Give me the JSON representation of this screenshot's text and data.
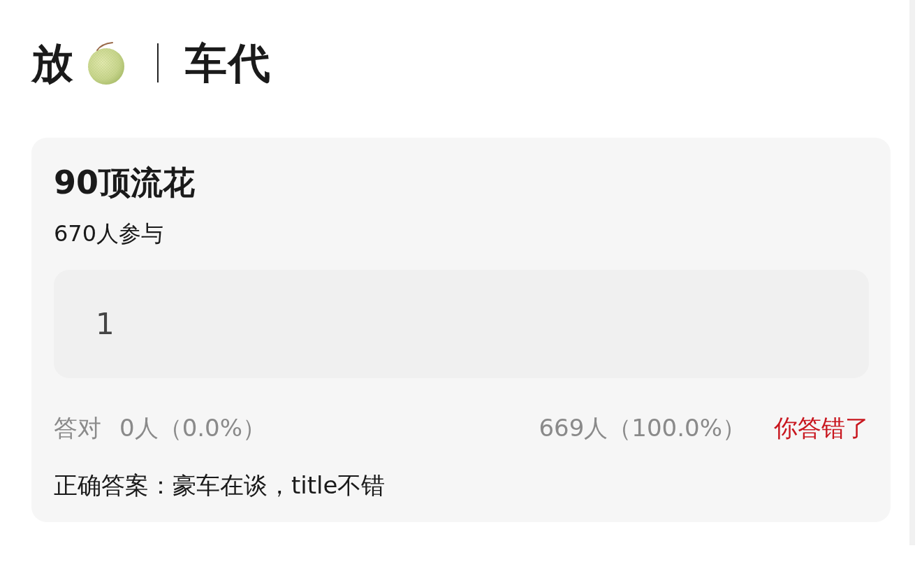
{
  "header": {
    "prefix": "放",
    "suffix": "车代"
  },
  "quiz": {
    "title": "90顶流花",
    "participants": "670人参与",
    "answer": {
      "value": "1"
    },
    "stats": {
      "correct_label": "答对",
      "correct_count": "0人（0.0%）",
      "wrong_count": "669人（100.0%）",
      "result": "你答错了",
      "result_correct": false
    },
    "correct_answer": "正确答案：豪车在谈，title不错"
  }
}
